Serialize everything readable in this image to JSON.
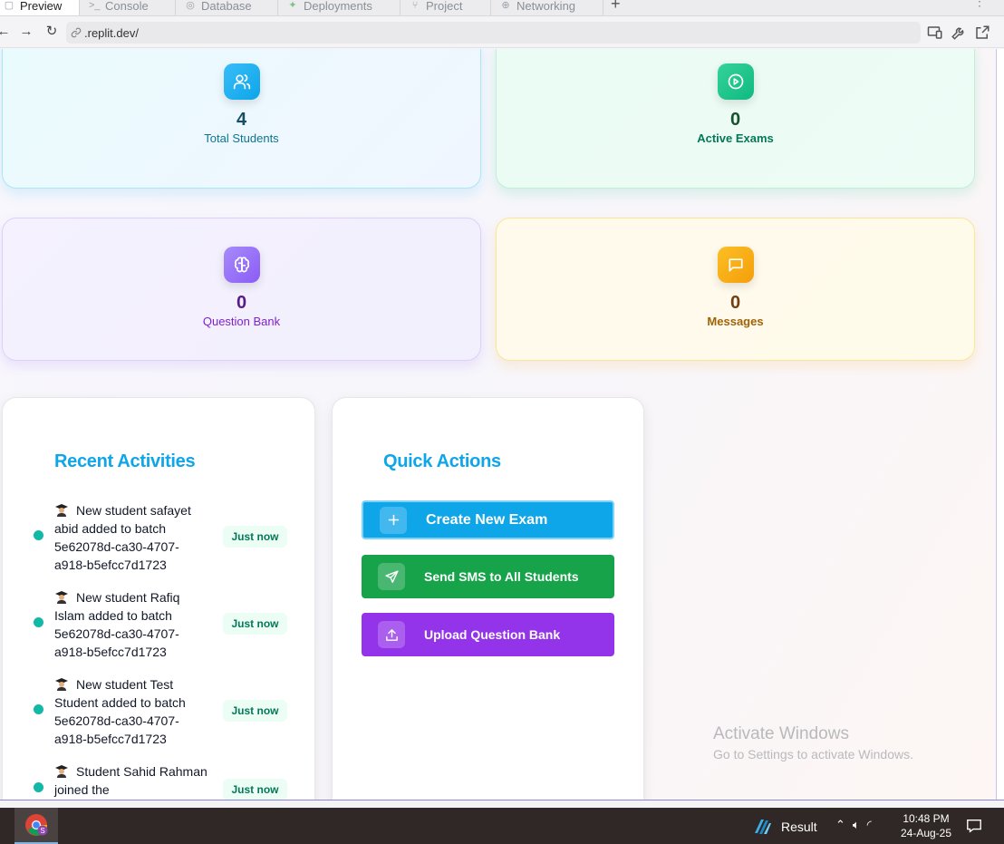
{
  "browser": {
    "tabs": [
      {
        "label": "Preview",
        "icon": "preview-icon",
        "active": true
      },
      {
        "label": "Console",
        "icon": "console-icon"
      },
      {
        "label": "Database",
        "icon": "database-icon"
      },
      {
        "label": "Deployments",
        "icon": "deployments-icon"
      },
      {
        "label": "Project",
        "icon": "project-icon"
      },
      {
        "label": "Networking",
        "icon": "networking-icon"
      }
    ],
    "url": ".replit.dev/"
  },
  "stats": {
    "students": {
      "value": "4",
      "label": "Total Students",
      "icon": "users-icon"
    },
    "exams": {
      "value": "0",
      "label": "Active Exams",
      "icon": "play-circle-icon"
    },
    "qbank": {
      "value": "0",
      "label": "Question Bank",
      "icon": "brain-icon"
    },
    "messages": {
      "value": "0",
      "label": "Messages",
      "icon": "message-icon"
    }
  },
  "activities": {
    "title": "Recent Activities",
    "items": [
      {
        "text": "New student safayet abid added to batch 5e62078d-ca30-4707-a918-b5efcc7d1723",
        "time": "Just now"
      },
      {
        "text": "New student Rafiq Islam added to batch 5e62078d-ca30-4707-a918-b5efcc7d1723",
        "time": "Just now"
      },
      {
        "text": "New student Test Student added to batch 5e62078d-ca30-4707-a918-b5efcc7d1723",
        "time": "Just now"
      },
      {
        "text": "Student Sahid Rahman joined the",
        "time": "Just now"
      }
    ]
  },
  "quick_actions": {
    "title": "Quick Actions",
    "create_exam": "Create New Exam",
    "send_sms": "Send SMS to All Students",
    "upload_qbank": "Upload Question Bank"
  },
  "watermark": {
    "line1": "Activate Windows",
    "line2": "Go to Settings to activate Windows."
  },
  "taskbar": {
    "result_label": "Result",
    "time": "10:48 PM",
    "date": "24-Aug-25"
  },
  "colors": {
    "accent": "#0ea5e9",
    "sms_button": "#16a34a",
    "upload_button": "#9333ea",
    "activity_dot": "#14b8a6"
  }
}
